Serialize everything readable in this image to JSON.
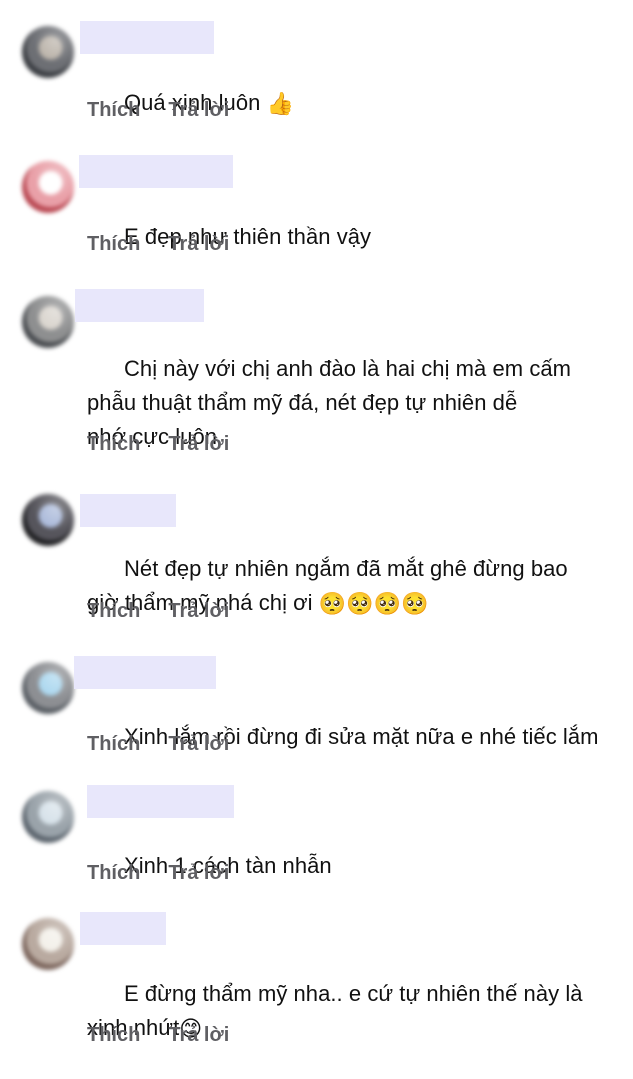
{
  "comments": [
    {
      "text_parts": [
        "Quá xinh luôn ",
        "👍"
      ],
      "like_label": "Thích",
      "reply_label": "Trả lời",
      "avatar_colors": [
        "#6d6f74",
        "#b8b0a6",
        "#3c3f44"
      ]
    },
    {
      "text_parts": [
        "E đẹp như thiên thần vậy"
      ],
      "like_label": "Thích",
      "reply_label": "Trả lời",
      "avatar_colors": [
        "#e9a0a8",
        "#ffffff",
        "#ba4a54"
      ]
    },
    {
      "text_parts": [
        "Chị này với chị anh đào là hai chị mà em cấm\nphẫu thuật thẩm mỹ đá, nét đẹp tự nhiên dễ\nnhớ cực luôn"
      ],
      "like_label": "Thích",
      "reply_label": "Trả lời",
      "avatar_colors": [
        "#8e8f90",
        "#d7d2cb",
        "#4a4d51"
      ]
    },
    {
      "text_parts": [
        "Nét đẹp tự nhiên ngắm đã mắt ghê đừng bao\ngiờ thẩm mỹ nhá chị ơi ",
        "🥺🥺🥺🥺"
      ],
      "like_label": "Thích",
      "reply_label": "Trả lời",
      "avatar_colors": [
        "#56555c",
        "#a6b6d8",
        "#232326"
      ]
    },
    {
      "text_parts": [
        "Xinh lắm rồi đừng đi sửa mặt nữa e nhé tiếc lắm"
      ],
      "like_label": "Thích",
      "reply_label": "Trả lời",
      "avatar_colors": [
        "#8d8f93",
        "#a7d5ee",
        "#5b6066"
      ]
    },
    {
      "text_parts": [
        "Xinh 1 cách tàn nhẫn"
      ],
      "like_label": "Thích",
      "reply_label": "Trả lời",
      "avatar_colors": [
        "#9aa3aa",
        "#d4e0e8",
        "#5d666f"
      ]
    },
    {
      "text_parts": [
        "E đừng thẩm mỹ nha.. e cứ tự nhiên thế này là\nxinh nhứt",
        "😊"
      ],
      "like_label": "Thích",
      "reply_label": "Trả lời",
      "avatar_colors": [
        "#b9aaa0",
        "#f2efe8",
        "#7e685f"
      ]
    }
  ]
}
